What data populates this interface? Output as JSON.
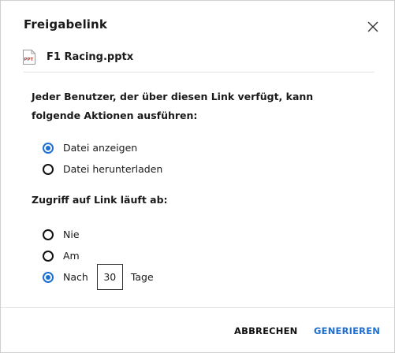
{
  "dialog": {
    "title": "Freigabelink",
    "file_name": "F1 Racing.pptx",
    "file_icon_label": "PPT"
  },
  "description": "Jeder Benutzer, der über diesen Link verfügt, kann folgende Aktionen ausführen:",
  "actions": [
    {
      "label": "Datei anzeigen",
      "checked": true
    },
    {
      "label": "Datei herunterladen",
      "checked": false
    }
  ],
  "expiry": {
    "label": "Zugriff auf Link läuft ab:",
    "options": [
      {
        "label": "Nie",
        "checked": false
      },
      {
        "label": "Am",
        "checked": false
      },
      {
        "label": "Nach",
        "checked": true
      }
    ],
    "days_value": "30",
    "days_unit": "Tage"
  },
  "buttons": {
    "cancel": "ABBRECHEN",
    "generate": "GENERIEREN"
  },
  "colors": {
    "accent": "#1f6fd1",
    "icon_red": "#c0392b"
  }
}
